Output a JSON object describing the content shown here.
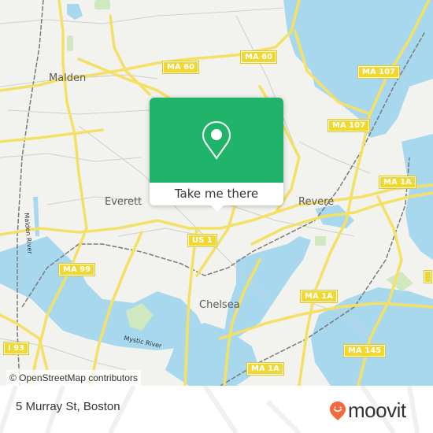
{
  "map": {
    "colors": {
      "land": "#f2f2ef",
      "water": "#a8d8ee",
      "road": "#f5e066",
      "minor_road": "#c8c8c8",
      "park": "#cfe8c0",
      "rail": "#777777"
    },
    "places": [
      {
        "name": "Malden"
      },
      {
        "name": "Everett"
      },
      {
        "name": "Revere"
      },
      {
        "name": "Chelsea"
      }
    ],
    "water_labels": [
      {
        "name": "Malden River"
      },
      {
        "name": "Mystic River"
      }
    ],
    "route_shields": [
      {
        "label": "MA 60"
      },
      {
        "label": "MA 60"
      },
      {
        "label": "MA 107"
      },
      {
        "label": "MA 107"
      },
      {
        "label": "MA 1A"
      },
      {
        "label": "US 1"
      },
      {
        "label": "MA 99"
      },
      {
        "label": "MA 1A"
      },
      {
        "label": "I 93"
      },
      {
        "label": "MA 145"
      },
      {
        "label": "MA 1A"
      }
    ],
    "attribution": "© OpenStreetMap contributors"
  },
  "popup": {
    "icon": "location-pin-icon",
    "accent": "#1fb46a",
    "cta_label": "Take me there"
  },
  "footer": {
    "address": "5 Murray St, Boston",
    "brand": "moovit",
    "brand_color": "#f26a3d"
  }
}
